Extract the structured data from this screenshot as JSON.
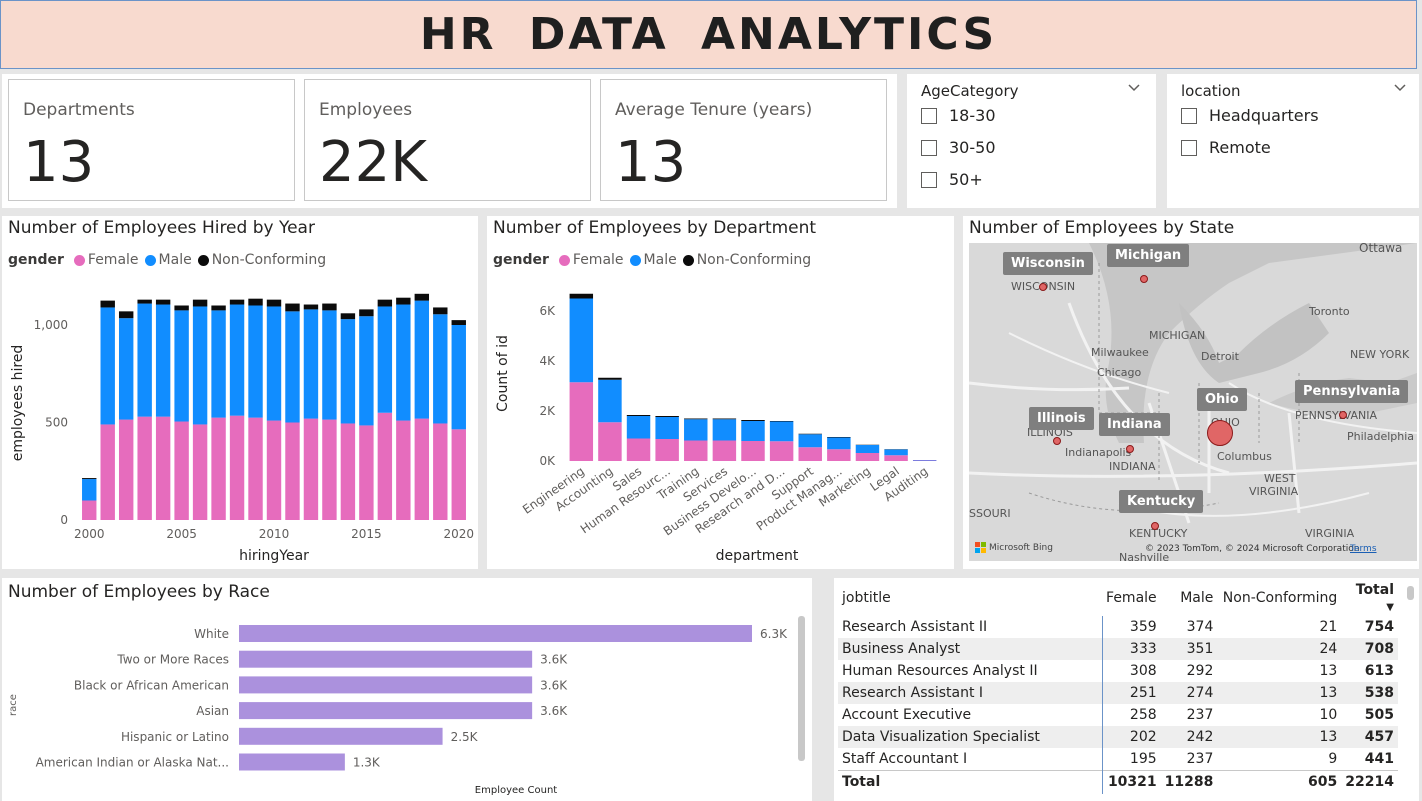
{
  "title": "HR DATA ANALYTICS",
  "cards": [
    {
      "label": "Departments",
      "value": "13"
    },
    {
      "label": "Employees",
      "value": "22K"
    },
    {
      "label": "Average Tenure (years)",
      "value": "13"
    }
  ],
  "slicers": {
    "age": {
      "title": "AgeCategory",
      "items": [
        "18-30",
        "30-50",
        "50+"
      ]
    },
    "location": {
      "title": "location",
      "items": [
        "Headquarters",
        "Remote"
      ]
    }
  },
  "colors": {
    "female": "#e66cbd",
    "male": "#118dff",
    "nonconforming": "#0b0b0b",
    "race_bar": "#ab91dd",
    "title_bg": "#f8dacf"
  },
  "hired_chart": {
    "title": "Number of Employees Hired by Year",
    "legend_title": "gender",
    "legend": [
      "Female",
      "Male",
      "Non-Conforming"
    ],
    "xlabel": "hiringYear",
    "ylabel": "employees hired"
  },
  "dept_chart": {
    "title": "Number of Employees by Department",
    "legend_title": "gender",
    "legend": [
      "Female",
      "Male",
      "Non-Conforming"
    ],
    "xlabel": "department",
    "ylabel": "Count of id"
  },
  "map": {
    "title": "Number of Employees by State",
    "states": [
      "Wisconsin",
      "Michigan",
      "Illinois",
      "Indiana",
      "Ohio",
      "Pennsylvania",
      "Kentucky"
    ],
    "place_labels": [
      "WISCONSIN",
      "Ottawa",
      "MICHIGAN",
      "Milwaukee",
      "Toronto",
      "Detroit",
      "NEW YORK",
      "Chicago",
      "PENNSYLVANIA",
      "ILLINOIS",
      "Philadelphia",
      "Indianapolis",
      "Columbus",
      "INDIANA",
      "WEST",
      "VIRGINIA",
      "SSOURI",
      "KENTUCKY",
      "VIRGINIA",
      "Nashville",
      "OHIO"
    ],
    "attribution": "Microsoft Bing",
    "copyright": "© 2023 TomTom, © 2024 Microsoft Corporation",
    "terms": "Terms"
  },
  "race_chart": {
    "title": "Number of Employees by Race",
    "ylabel": "race",
    "xlabel": "Employee Count"
  },
  "jobtable": {
    "headers": [
      "jobtitle",
      "Female",
      "Male",
      "Non-Conforming",
      "Total"
    ],
    "rows": [
      [
        "Research Assistant II",
        "359",
        "374",
        "21",
        "754"
      ],
      [
        "Business Analyst",
        "333",
        "351",
        "24",
        "708"
      ],
      [
        "Human Resources Analyst II",
        "308",
        "292",
        "13",
        "613"
      ],
      [
        "Research Assistant I",
        "251",
        "274",
        "13",
        "538"
      ],
      [
        "Account Executive",
        "258",
        "237",
        "10",
        "505"
      ],
      [
        "Data Visualization Specialist",
        "202",
        "242",
        "13",
        "457"
      ],
      [
        "Staff Accountant I",
        "195",
        "237",
        "9",
        "441"
      ]
    ],
    "total": [
      "Total",
      "10321",
      "11288",
      "605",
      "22214"
    ]
  },
  "chart_data": [
    {
      "type": "bar",
      "stacked": true,
      "title": "Number of Employees Hired by Year",
      "xlabel": "hiringYear",
      "ylabel": "employees hired",
      "x": [
        2000,
        2001,
        2002,
        2003,
        2004,
        2005,
        2006,
        2007,
        2008,
        2009,
        2010,
        2011,
        2012,
        2013,
        2014,
        2015,
        2016,
        2017,
        2018,
        2019,
        2020
      ],
      "xticks": [
        "2000",
        "2005",
        "2010",
        "2015",
        "2020"
      ],
      "yticks": [
        "0",
        "500",
        "1,000"
      ],
      "ylim": [
        0,
        1200
      ],
      "series": [
        {
          "name": "Female",
          "values": [
            100,
            490,
            515,
            530,
            530,
            505,
            490,
            525,
            535,
            525,
            510,
            500,
            520,
            515,
            495,
            485,
            550,
            510,
            520,
            495,
            465
          ]
        },
        {
          "name": "Male",
          "values": [
            110,
            600,
            520,
            580,
            575,
            570,
            605,
            550,
            570,
            575,
            585,
            570,
            560,
            560,
            535,
            560,
            545,
            595,
            605,
            560,
            535
          ]
        },
        {
          "name": "Non-Conforming",
          "values": [
            5,
            35,
            35,
            20,
            25,
            25,
            35,
            25,
            25,
            35,
            35,
            40,
            25,
            35,
            30,
            35,
            35,
            35,
            35,
            35,
            25
          ]
        }
      ],
      "legend": "top-left",
      "grid": false
    },
    {
      "type": "bar",
      "stacked": true,
      "title": "Number of Employees by Department",
      "xlabel": "department",
      "ylabel": "Count of id",
      "categories": [
        "Engineering",
        "Accounting",
        "Sales",
        "Human Resourc...",
        "Training",
        "Services",
        "Business Develo...",
        "Research and D...",
        "Support",
        "Product Manag...",
        "Marketing",
        "Legal",
        "Auditing"
      ],
      "yticks": [
        "0K",
        "2K",
        "4K",
        "6K"
      ],
      "ylim": [
        0,
        7000
      ],
      "series": [
        {
          "name": "Female",
          "values": [
            3150,
            1550,
            900,
            880,
            820,
            820,
            800,
            790,
            550,
            470,
            320,
            230,
            20
          ]
        },
        {
          "name": "Male",
          "values": [
            3350,
            1700,
            900,
            880,
            850,
            850,
            800,
            790,
            520,
            470,
            320,
            230,
            20
          ]
        },
        {
          "name": "Non-Conforming",
          "values": [
            190,
            80,
            40,
            40,
            30,
            30,
            40,
            20,
            20,
            20,
            10,
            10,
            0
          ]
        }
      ],
      "legend": "top-left",
      "grid": false
    },
    {
      "type": "bar",
      "orientation": "horizontal",
      "title": "Number of Employees by Race",
      "xlabel": "Employee Count",
      "ylabel": "race",
      "categories": [
        "White",
        "Two or More Races",
        "Black or African American",
        "Asian",
        "Hispanic or Latino",
        "American Indian or Alaska Nat..."
      ],
      "values": [
        6300,
        3600,
        3600,
        3600,
        2500,
        1300
      ],
      "data_labels": [
        "6.3K",
        "3.6K",
        "3.6K",
        "3.6K",
        "2.5K",
        "1.3K"
      ]
    }
  ]
}
